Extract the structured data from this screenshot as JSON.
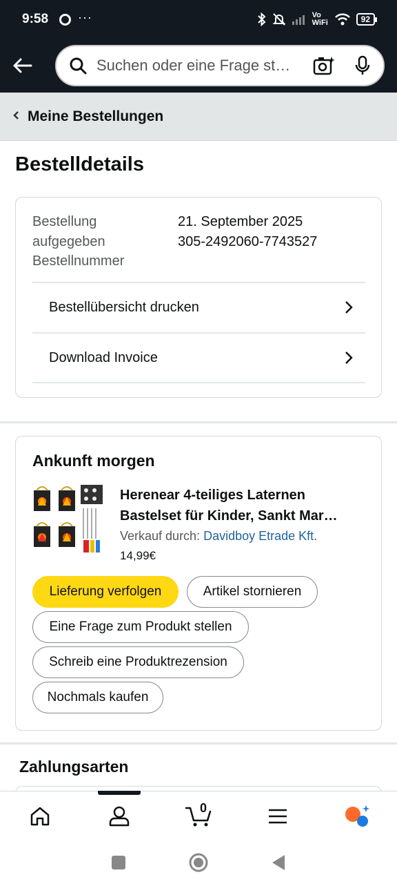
{
  "status_bar": {
    "time": "9:58",
    "dots": "···",
    "vowifi": "Vo WiFi",
    "battery": "92"
  },
  "search": {
    "placeholder": "Suchen oder eine Frage st…"
  },
  "breadcrumb": {
    "label": "Meine Bestellungen"
  },
  "page_title": "Bestelldetails",
  "order": {
    "labels": [
      "Bestellung",
      "aufgegeben",
      "Bestellnummer"
    ],
    "date": "21. September 2025",
    "number": "305-2492060-7743527",
    "links": [
      {
        "label": "Bestellübersicht drucken"
      },
      {
        "label": "Download Invoice"
      }
    ]
  },
  "item_card": {
    "heading": "Ankunft morgen",
    "title_line1": "Herenear 4-teiliges Laternen",
    "title_line2": "Bastelset für Kinder, Sankt Mar…",
    "seller_prefix": "Verkauf durch: ",
    "seller": "Davidboy Etrade Kft",
    "seller_suffix": ".",
    "price": "14,99€",
    "buttons": {
      "track": "Lieferung verfolgen",
      "cancel": "Artikel stornieren",
      "question": "Eine Frage zum Produkt stellen",
      "review": "Schreib eine Produktrezension",
      "rebuy": "Nochmals kaufen"
    }
  },
  "payment_section": {
    "title": "Zahlungsarten"
  },
  "bottom_nav": {
    "cart_count": "0"
  },
  "colors": {
    "header_bg": "#131921",
    "primary_button": "#ffd814",
    "link": "#2162a1",
    "breadcrumb_bg": "#e3e6e6"
  }
}
